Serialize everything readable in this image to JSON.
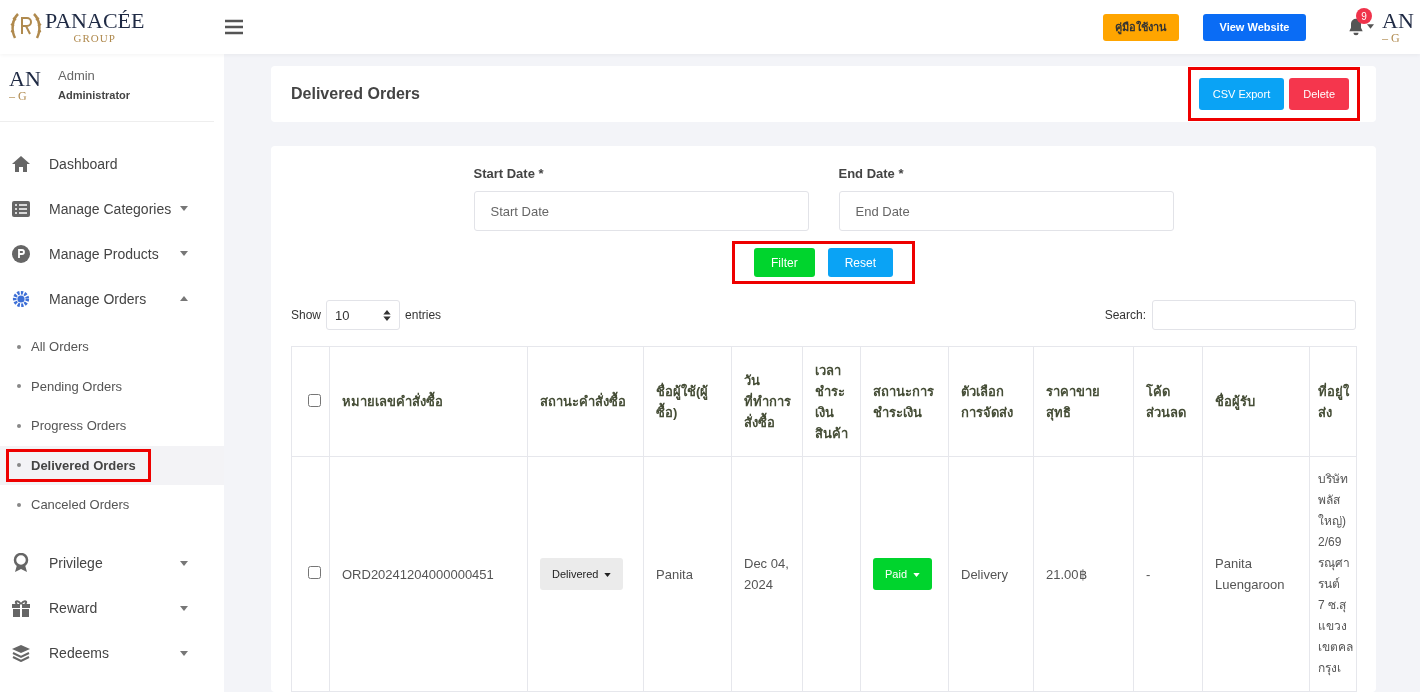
{
  "topbar": {
    "logo": {
      "name": "PANACÉE",
      "tagline": "GROUP"
    },
    "guide_button": "คู่มือใช้งาน",
    "website_button": "View Website",
    "notifications": {
      "count": "9"
    },
    "avatar": {
      "line1": "AN",
      "line2": "– G"
    }
  },
  "sidebar": {
    "user": {
      "avatar": {
        "line1": "AN",
        "line2": "– G"
      },
      "name": "Admin",
      "role": "Administrator"
    },
    "items": [
      {
        "label": "Dashboard",
        "has_caret": false
      },
      {
        "label": "Manage Categories",
        "has_caret": true,
        "expanded": false
      },
      {
        "label": "Manage Products",
        "has_caret": true,
        "expanded": false
      },
      {
        "label": "Manage Orders",
        "has_caret": true,
        "expanded": true,
        "children": [
          {
            "label": "All Orders",
            "selected": false
          },
          {
            "label": "Pending Orders",
            "selected": false
          },
          {
            "label": "Progress Orders",
            "selected": false
          },
          {
            "label": "Delivered Orders",
            "selected": true,
            "highlighted": true
          },
          {
            "label": "Canceled Orders",
            "selected": false
          }
        ]
      },
      {
        "label": "Privilege",
        "has_caret": true,
        "expanded": false
      },
      {
        "label": "Reward",
        "has_caret": true,
        "expanded": false
      },
      {
        "label": "Redeems",
        "has_caret": true,
        "expanded": false
      }
    ]
  },
  "page_header": {
    "title": "Delivered Orders",
    "highlighted": true,
    "actions": [
      {
        "label": "CSV Export",
        "kind": "primary"
      },
      {
        "label": "Delete",
        "kind": "danger"
      }
    ]
  },
  "filter": {
    "start_label": "Start Date *",
    "start_placeholder": "Start Date",
    "end_label": "End Date *",
    "end_placeholder": "End Date",
    "highlighted": true,
    "buttons": [
      {
        "label": "Filter",
        "kind": "success"
      },
      {
        "label": "Reset",
        "kind": "primary"
      }
    ]
  },
  "table": {
    "show_label": "Show",
    "page_size": "10",
    "entries_label": "entries",
    "search_label": "Search:",
    "all_checked": false,
    "columns": [
      "หมายเลขคำสั่งซื้อ",
      "สถานะคำสั่งซื้อ",
      "ชื่อผู้ใช้(ผู้ซื้อ)",
      "วันที่ทำการสั่งซื้อ",
      "เวลาชำระเงินสินค้า",
      "สถานะการชำระเงิน",
      "ตัวเลือกการจัดส่ง",
      "ราคาขายสุทธิ",
      "โค้ดส่วนลด",
      "ชื่อผู้รับ",
      "ที่อยู่ใ ส่ง"
    ],
    "rows": [
      {
        "checked": false,
        "order_no": "ORD20241204000000451",
        "status": "Delivered",
        "user": "Panita",
        "date": "Dec 04, 2024",
        "payment": "Paid",
        "shipping": "Delivery",
        "price": "21.00฿",
        "discount_code": "-",
        "receiver": "Panita Luengaroon",
        "address_lines": [
          "บริษัท",
          "พลัส",
          "ใหญ่)",
          "2/69",
          "รณุศา",
          "รนต์",
          "7 ซ.สุ",
          "แขวง",
          "เขตคล",
          "กรุงเ"
        ]
      }
    ]
  }
}
